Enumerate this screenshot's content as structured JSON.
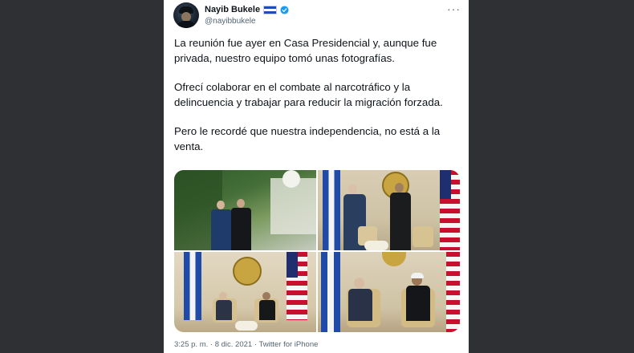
{
  "author": {
    "display_name": "Nayib Bukele",
    "handle": "@nayibbukele",
    "flag_icon": "el-salvador-flag-emoji",
    "verified_icon": "verified-badge-icon"
  },
  "tweet": {
    "paragraphs": [
      "La reunión fue ayer en Casa Presidencial y, aunque fue privada, nuestro equipo tomó unas fotografías.",
      "Ofrecí colaborar en el combate al narcotráfico y la delincuencia y trabajar para reducir la migración forzada.",
      "Pero le recordé que nuestra independencia, no está a la venta."
    ]
  },
  "media": {
    "photo_count": 4
  },
  "footer": {
    "time": "3:25 p. m.",
    "separator": "·",
    "date": "8 dic. 2021",
    "source": "Twitter for iPhone"
  },
  "colors": {
    "page_bg": "#2e3033",
    "card_bg": "#ffffff",
    "text_primary": "#0f1419",
    "text_secondary": "#536471",
    "verified_blue": "#1d9bf0"
  }
}
